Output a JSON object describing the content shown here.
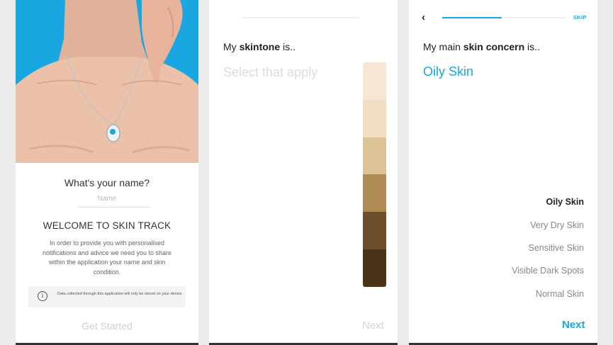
{
  "screen1": {
    "hero_image": "woman-wearing-skin-track-pendant",
    "question": "What's your name?",
    "name_placeholder": "Name",
    "welcome_title": "WELCOME TO SKIN TRACK",
    "description": "In order to provide you with personalised notifications and advice we need you to share within the application your name and skin condition.",
    "notice_icon": "info-icon",
    "notice_text": "Data collected through this application will only be stored on your device.",
    "cta_label": "Get Started"
  },
  "screen2": {
    "heading_prefix": "My ",
    "heading_bold": "skintone",
    "heading_suffix": " is..",
    "subheading": "Select that apply",
    "palette_colors": [
      "#f5e7d3",
      "#f2dfc3",
      "#dcc396",
      "#b08b56",
      "#6e4f2c",
      "#4b3219"
    ],
    "next_label": "Next"
  },
  "screen3": {
    "back_icon": "chevron-left-icon",
    "skip_label": "SKIP",
    "progress": 0.48,
    "heading_prefix": "My main ",
    "heading_bold": "skin concern",
    "heading_suffix": " is..",
    "selected_value": "Oily Skin",
    "options": [
      "Oily Skin",
      "Very Dry Skin",
      "Sensitive Skin",
      "Visible Dark Spots",
      "Normal Skin"
    ],
    "selected_index": 0,
    "next_label": "Next"
  },
  "colors": {
    "accent": "#1aa7e1",
    "hero_background": "#1aa7e1"
  }
}
